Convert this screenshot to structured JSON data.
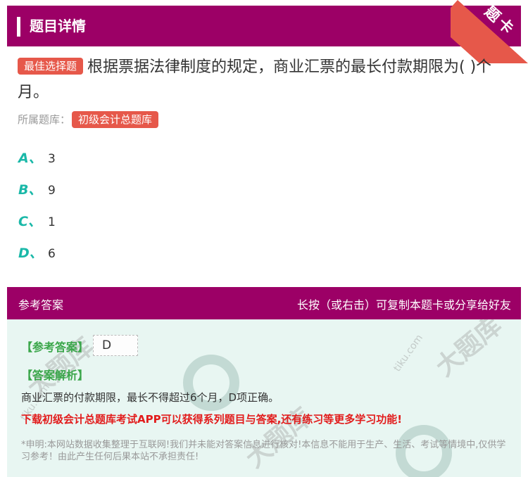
{
  "header": {
    "title": "题目详情"
  },
  "corner": {
    "label": "题卡"
  },
  "question": {
    "type_tag": "最佳选择题",
    "text": "根据票据法律制度的规定，商业汇票的最长付款期限为(    )个月。",
    "bank_label": "所属题库：",
    "bank_tag": "初级会计总题库"
  },
  "options": [
    {
      "letter": "A、",
      "value": "3"
    },
    {
      "letter": "B、",
      "value": "9"
    },
    {
      "letter": "C、",
      "value": "1"
    },
    {
      "letter": "D、",
      "value": "6"
    }
  ],
  "answer_header": {
    "left": "参考答案",
    "right": "长按（或右击）可复制本题卡或分享给好友"
  },
  "answer": {
    "ref_label": "【参考答案】",
    "ref_value": "D",
    "analysis_label": "【答案解析】",
    "analysis_text": "商业汇票的付款期限，最长不得超过6个月，D项正确。",
    "promo_text": "下载初级会计总题库考试APP可以获得系列题目与答案,还有练习等更多学习功能!",
    "disclaimer": "*申明:本网站数据收集整理于互联网!我们并未能对答案信息进行核对!本信息不能用于生产、生活、考试等情境中,仅供学习参考！由此产生任何后果本站不承担责任!"
  },
  "colors": {
    "brand": "#9c0066",
    "tag": "#e6584a",
    "option_letter": "#1ab8a8",
    "answer_green": "#3aa64a",
    "promo_red": "#e21c1c"
  }
}
